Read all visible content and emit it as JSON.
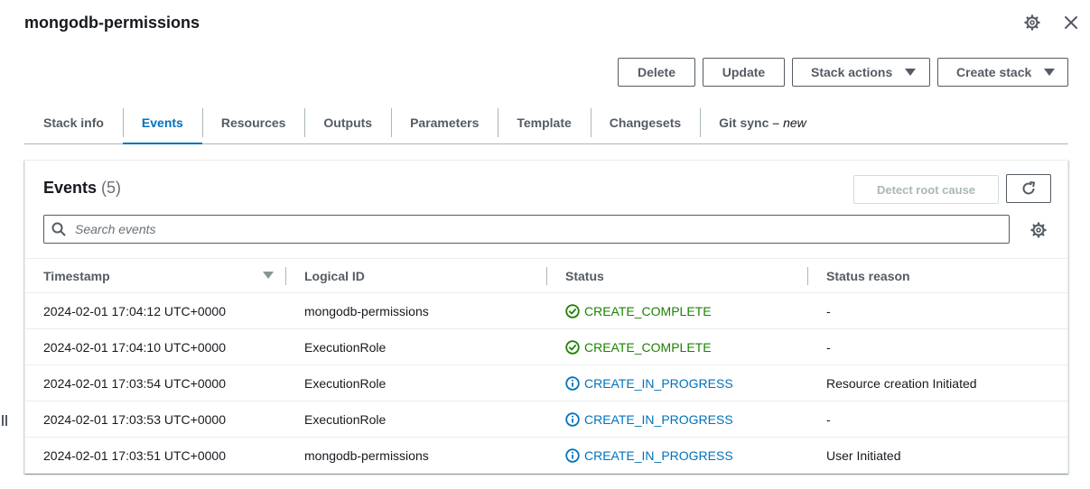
{
  "header": {
    "title": "mongodb-permissions",
    "settings_icon": "gear-icon",
    "close_icon": "close-icon"
  },
  "actions": {
    "delete_label": "Delete",
    "update_label": "Update",
    "stack_actions_label": "Stack actions",
    "create_stack_label": "Create stack"
  },
  "tabs": [
    {
      "label": "Stack info",
      "active": false
    },
    {
      "label": "Events",
      "active": true
    },
    {
      "label": "Resources",
      "active": false
    },
    {
      "label": "Outputs",
      "active": false
    },
    {
      "label": "Parameters",
      "active": false
    },
    {
      "label": "Template",
      "active": false
    },
    {
      "label": "Changesets",
      "active": false
    },
    {
      "label": "Git sync –",
      "suffix": "new",
      "active": false
    }
  ],
  "events": {
    "title": "Events",
    "count": "(5)",
    "detect_label": "Detect root cause",
    "search_placeholder": "Search events",
    "columns": [
      "Timestamp",
      "Logical ID",
      "Status",
      "Status reason"
    ],
    "rows": [
      {
        "timestamp": "2024-02-01 17:04:12 UTC+0000",
        "logical_id": "mongodb-permissions",
        "status": "CREATE_COMPLETE",
        "status_type": "success",
        "reason": "-"
      },
      {
        "timestamp": "2024-02-01 17:04:10 UTC+0000",
        "logical_id": "ExecutionRole",
        "status": "CREATE_COMPLETE",
        "status_type": "success",
        "reason": "-"
      },
      {
        "timestamp": "2024-02-01 17:03:54 UTC+0000",
        "logical_id": "ExecutionRole",
        "status": "CREATE_IN_PROGRESS",
        "status_type": "info",
        "reason": "Resource creation Initiated"
      },
      {
        "timestamp": "2024-02-01 17:03:53 UTC+0000",
        "logical_id": "ExecutionRole",
        "status": "CREATE_IN_PROGRESS",
        "status_type": "info",
        "reason": "-"
      },
      {
        "timestamp": "2024-02-01 17:03:51 UTC+0000",
        "logical_id": "mongodb-permissions",
        "status": "CREATE_IN_PROGRESS",
        "status_type": "info",
        "reason": "User Initiated"
      }
    ]
  },
  "colors": {
    "accent": "#0073bb",
    "success": "#1d8102",
    "text": "#16191f",
    "muted": "#545b64"
  }
}
